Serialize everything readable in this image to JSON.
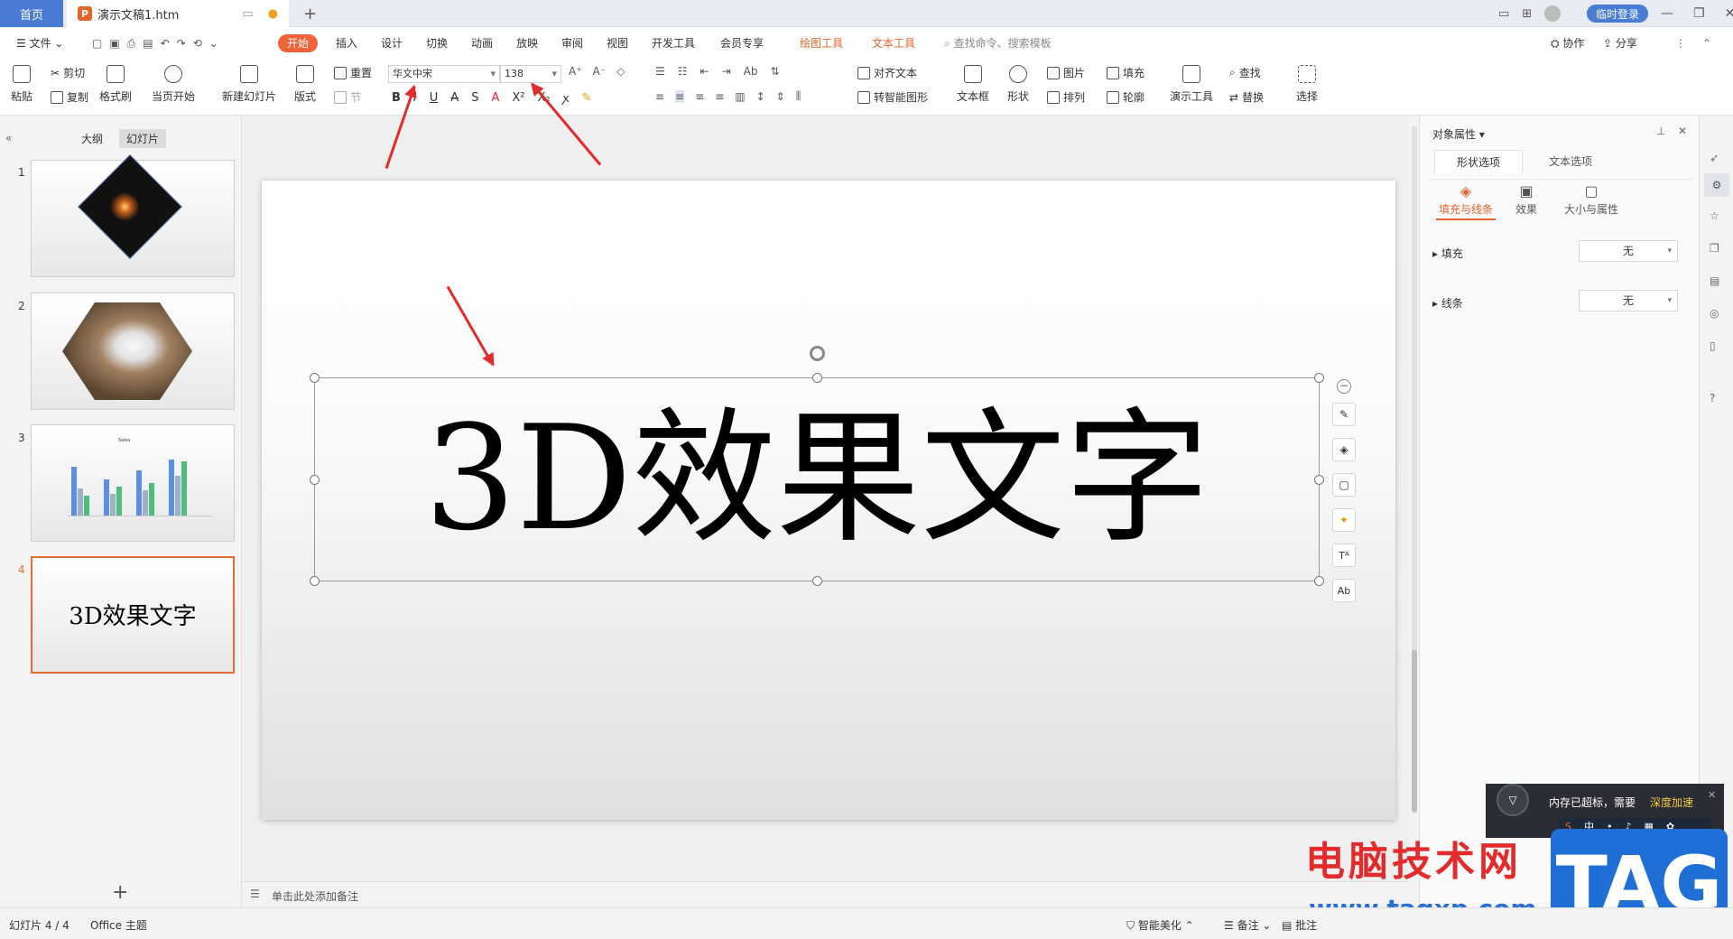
{
  "tabs": {
    "home": "首页",
    "doc": "演示文稿1.htm",
    "login": "临时登录"
  },
  "menu": {
    "file": "文件",
    "tabs": [
      "开始",
      "插入",
      "设计",
      "切换",
      "动画",
      "放映",
      "审阅",
      "视图",
      "开发工具",
      "会员专享"
    ],
    "context_tabs": [
      "绘图工具",
      "文本工具"
    ],
    "search_placeholder": "查找命令、搜索模板",
    "collab": "协作",
    "share": "分享"
  },
  "ribbon": {
    "paste": "粘贴",
    "cut": "剪切",
    "copy": "复制",
    "format_painter": "格式刷",
    "start_from_current": "当页开始",
    "new_slide": "新建幻灯片",
    "layout": "版式",
    "reset": "重置",
    "section": "节",
    "font_name": "华文中宋",
    "font_size": "138",
    "align_text": "对齐文本",
    "smart_shape": "转智能图形",
    "textbox": "文本框",
    "shape": "形状",
    "picture": "图片",
    "arrange": "排列",
    "fill": "填充",
    "outline": "轮廓",
    "presenter_tools": "演示工具",
    "find": "查找",
    "replace": "替换",
    "select": "选择"
  },
  "left_panel": {
    "tab_outline": "大纲",
    "tab_slides": "幻灯片",
    "slides": [
      {
        "num": "1"
      },
      {
        "num": "2"
      },
      {
        "num": "3",
        "chart_title": "Sales"
      },
      {
        "num": "4",
        "text": "3D效果文字"
      }
    ]
  },
  "slide": {
    "main_text": "3D效果文字"
  },
  "notes_placeholder": "单击此处添加备注",
  "right_panel": {
    "title": "对象属性",
    "tab_shape": "形状选项",
    "tab_text": "文本选项",
    "sub_fill_line": "填充与线条",
    "sub_effects": "效果",
    "sub_size": "大小与属性",
    "fill_label": "填充",
    "fill_value": "无",
    "line_label": "线条",
    "line_value": "无"
  },
  "notification": {
    "text": "内存已超标，需要",
    "action": "深度加速"
  },
  "status": {
    "slide_indicator": "幻灯片 4 / 4",
    "theme": "Office 主题",
    "beautify": "智能美化",
    "notes": "备注",
    "comment": "批注"
  },
  "watermark": {
    "title": "电脑技术网",
    "url": "www.tagxp.com",
    "badge": "TAG"
  },
  "colors": {
    "accent": "#4a7cd6",
    "start_tab": "#f0623a",
    "context_tab": "#e8632b",
    "selection": "#e86c2b",
    "arrow": "#e32b2b"
  }
}
